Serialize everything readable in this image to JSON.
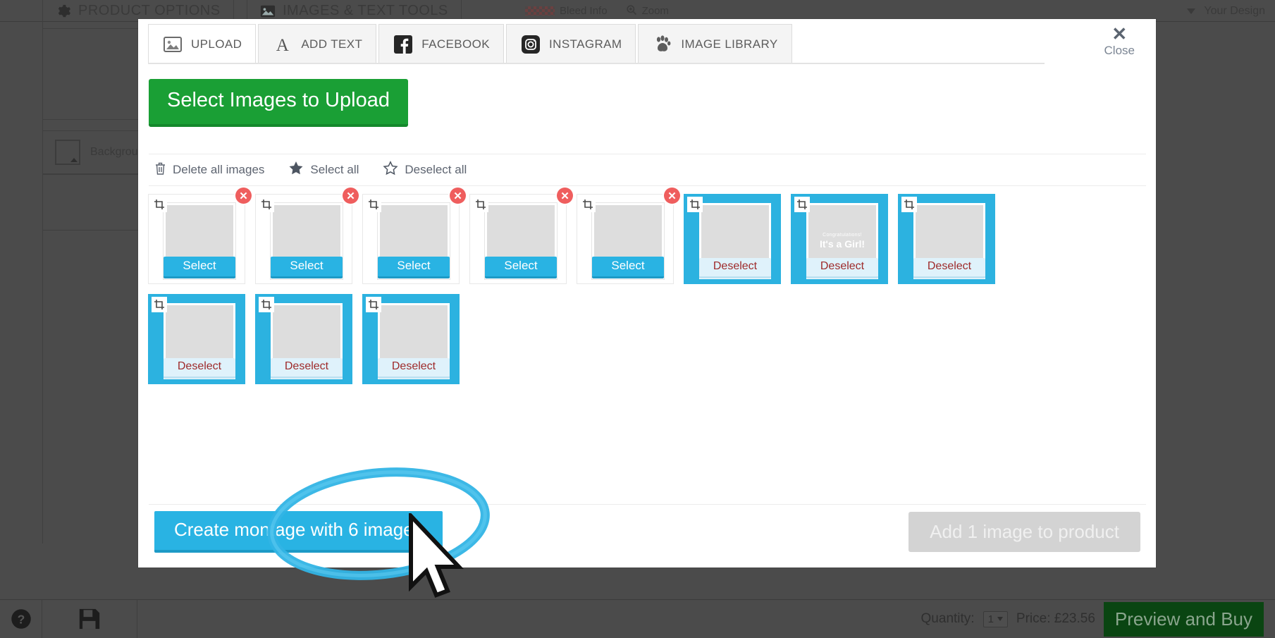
{
  "background": {
    "topbar": {
      "tabs": [
        {
          "label": "PRODUCT OPTIONS",
          "icon": "gear-icon"
        },
        {
          "label": "IMAGES & TEXT TOOLS",
          "icon": "image-icon"
        }
      ],
      "center_items": [
        {
          "label": "Bleed Info",
          "icon": "bleed-swatch-icon"
        },
        {
          "label": "Zoom",
          "icon": "magnifier-icon"
        }
      ],
      "right_label": "Your Design"
    },
    "left_panel": {
      "background_label": "Background"
    },
    "bottombar": {
      "help_icon": "question-circle-icon",
      "save_icon": "floppy-disk-icon",
      "quantity_label": "Quantity:",
      "quantity_value": "1",
      "price_label": "Price: £23.56",
      "preview_buy_label": "Preview and Buy"
    }
  },
  "modal": {
    "tabs": [
      {
        "label": "UPLOAD",
        "icon": "picture-icon",
        "active": true
      },
      {
        "label": "ADD TEXT",
        "icon": "letter-a-icon",
        "active": false
      },
      {
        "label": "FACEBOOK",
        "icon": "facebook-icon",
        "active": false
      },
      {
        "label": "INSTAGRAM",
        "icon": "instagram-icon",
        "active": false
      },
      {
        "label": "IMAGE LIBRARY",
        "icon": "paw-print-icon",
        "active": false
      }
    ],
    "close": {
      "label": "Close",
      "icon": "close-x-icon"
    },
    "upload_button_label": "Select Images to Upload",
    "toolbar": [
      {
        "label": "Delete all images",
        "icon": "trash-icon"
      },
      {
        "label": "Select all",
        "icon": "star-filled-icon"
      },
      {
        "label": "Deselect all",
        "icon": "star-outline-icon"
      }
    ],
    "images": [
      {
        "art": "ph1",
        "selected": false,
        "action_label": "Select",
        "deletable": true,
        "caption": ""
      },
      {
        "art": "ph2",
        "selected": false,
        "action_label": "Select",
        "deletable": true,
        "caption": ""
      },
      {
        "art": "ph3",
        "selected": false,
        "action_label": "Select",
        "deletable": true,
        "caption": ""
      },
      {
        "art": "ph4",
        "selected": false,
        "action_label": "Select",
        "deletable": true,
        "caption": ""
      },
      {
        "art": "ph5",
        "selected": false,
        "action_label": "Select",
        "deletable": true,
        "caption": ""
      },
      {
        "art": "ph6",
        "selected": true,
        "action_label": "Deselect",
        "deletable": false,
        "caption": ""
      },
      {
        "art": "ph7",
        "selected": true,
        "action_label": "Deselect",
        "deletable": false,
        "caption": "Congratulations! It's a Girl!"
      },
      {
        "art": "ph8",
        "selected": true,
        "action_label": "Deselect",
        "deletable": false,
        "caption": ""
      },
      {
        "art": "ph9",
        "selected": true,
        "action_label": "Deselect",
        "deletable": false,
        "caption": ""
      },
      {
        "art": "ph10",
        "selected": true,
        "action_label": "Deselect",
        "deletable": false,
        "caption": ""
      },
      {
        "art": "ph11",
        "selected": true,
        "action_label": "Deselect",
        "deletable": false,
        "caption": ""
      }
    ],
    "girl_card": {
      "line1": "Congratulations!",
      "line2": "It's a Girl!"
    },
    "footer": {
      "montage_label": "Create montage with 6 images",
      "add_to_product_label": "Add 1 image to product"
    },
    "delete_icon_glyph": "✕",
    "crop_icon": "crop-icon"
  },
  "colors": {
    "green": "#1a9f35",
    "cyan": "#29b3e3",
    "delete_red": "#ef5e5e",
    "deselect_text": "#9e2a2a",
    "annotation": "#32b4e5"
  }
}
